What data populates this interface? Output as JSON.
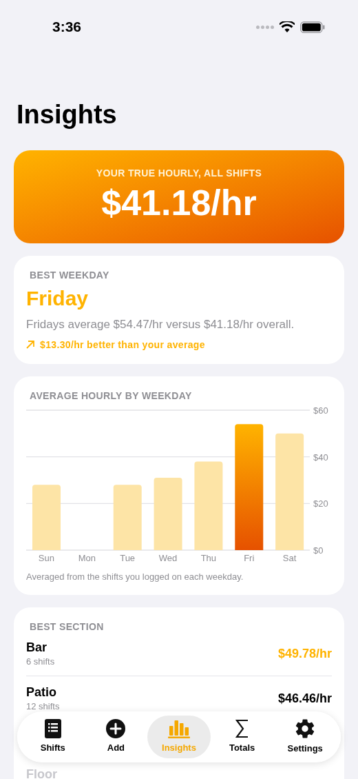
{
  "status_bar": {
    "time": "3:36"
  },
  "title": "Insights",
  "hero": {
    "label": "YOUR TRUE HOURLY, ALL SHIFTS",
    "value": "$41.18/hr"
  },
  "best_weekday": {
    "label": "BEST WEEKDAY",
    "day": "Friday",
    "description": "Fridays average $54.47/hr versus $41.18/hr overall.",
    "delta": "$13.30/hr better than your average"
  },
  "weekday_chart": {
    "title": "AVERAGE HOURLY BY WEEKDAY",
    "footnote": "Averaged from the shifts you logged on each weekday.",
    "chart_data": {
      "type": "bar",
      "stacked": true,
      "categories": [
        "Sun",
        "Mon",
        "Tue",
        "Wed",
        "Thu",
        "Fri",
        "Sat"
      ],
      "series": [
        {
          "color": "#fde4a6",
          "values": [
            28,
            null,
            28,
            31,
            38,
            null,
            50
          ]
        },
        {
          "color": "#e65100",
          "values": [
            null,
            null,
            null,
            null,
            null,
            54,
            null
          ]
        }
      ],
      "ylim": [
        0,
        60
      ],
      "yticks": [
        {
          "value": 0,
          "label": "$0"
        },
        {
          "value": 20,
          "label": "$20"
        },
        {
          "value": 40,
          "label": "$40"
        },
        {
          "value": 60,
          "label": "$60"
        }
      ]
    }
  },
  "best_section": {
    "label": "BEST SECTION",
    "rows": [
      {
        "name": "Bar",
        "shifts": "6 shifts",
        "value": "$49.78/hr",
        "best": true
      },
      {
        "name": "Patio",
        "shifts": "12 shifts",
        "value": "$46.46/hr",
        "best": false
      },
      {
        "name": "Floor"
      }
    ]
  },
  "tab_bar": [
    {
      "label": "Shifts",
      "kind": "list",
      "selected": false
    },
    {
      "label": "Add",
      "kind": "add",
      "selected": false
    },
    {
      "label": "Insights",
      "kind": "chart",
      "selected": true
    },
    {
      "label": "Totals",
      "kind": "sum",
      "selected": false
    },
    {
      "label": "Settings",
      "kind": "gear",
      "selected": false
    }
  ]
}
